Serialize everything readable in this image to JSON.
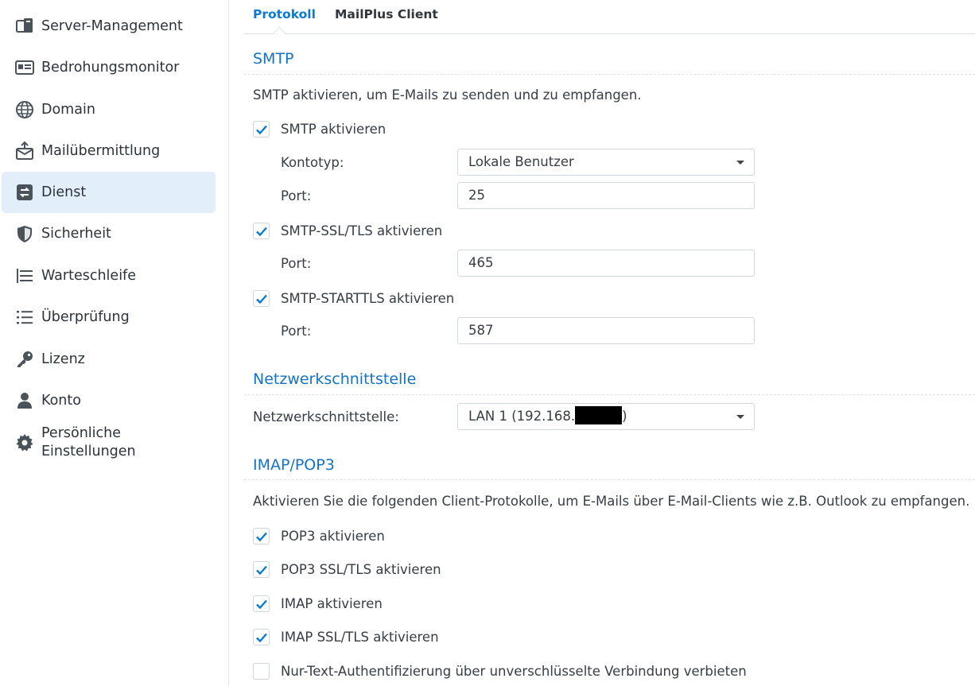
{
  "sidebar": {
    "items": [
      {
        "label": "Server-Management",
        "icon": "server-management-icon"
      },
      {
        "label": "Bedrohungsmonitor",
        "icon": "threat-monitor-icon"
      },
      {
        "label": "Domain",
        "icon": "globe-icon"
      },
      {
        "label": "Mailübermittlung",
        "icon": "mail-delivery-icon"
      },
      {
        "label": "Dienst",
        "icon": "service-icon",
        "active": true
      },
      {
        "label": "Sicherheit",
        "icon": "shield-icon"
      },
      {
        "label": "Warteschleife",
        "icon": "queue-icon"
      },
      {
        "label": "Überprüfung",
        "icon": "audit-list-icon"
      },
      {
        "label": "Lizenz",
        "icon": "key-icon"
      },
      {
        "label": "Konto",
        "icon": "person-icon"
      },
      {
        "label_line1": "Persönliche",
        "label_line2": "Einstellungen",
        "icon": "gear-icon"
      }
    ]
  },
  "tabs": [
    {
      "label": "Protokoll",
      "active": true
    },
    {
      "label": "MailPlus Client",
      "active": false
    }
  ],
  "smtp": {
    "title": "SMTP",
    "description": "SMTP aktivieren, um E-Mails zu senden und zu empfangen.",
    "enable_label": "SMTP aktivieren",
    "enable_checked": true,
    "account_type_label": "Kontotyp:",
    "account_type_value": "Lokale Benutzer",
    "port_label": "Port:",
    "port_value": "25",
    "ssl_label": "SMTP-SSL/TLS aktivieren",
    "ssl_checked": true,
    "ssl_port_label": "Port:",
    "ssl_port_value": "465",
    "starttls_label": "SMTP-STARTTLS aktivieren",
    "starttls_checked": true,
    "starttls_port_label": "Port:",
    "starttls_port_value": "587"
  },
  "network": {
    "title": "Netzwerkschnittstelle",
    "label": "Netzwerkschnittstelle:",
    "value_prefix": "LAN 1 (192.168.",
    "value_suffix": ")"
  },
  "imap": {
    "title": "IMAP/POP3",
    "description": "Aktivieren Sie die folgenden Client-Protokolle, um E-Mails über E-Mail-Clients wie z.B. Outlook zu empfangen.",
    "options": [
      {
        "label": "POP3 aktivieren",
        "checked": true
      },
      {
        "label": "POP3 SSL/TLS aktivieren",
        "checked": true
      },
      {
        "label": "IMAP aktivieren",
        "checked": true
      },
      {
        "label": "IMAP SSL/TLS aktivieren",
        "checked": true
      },
      {
        "label": "Nur-Text-Authentifizierung über unverschlüsselte Verbindung verbieten",
        "checked": false
      }
    ]
  },
  "colors": {
    "accent": "#0b7ad1",
    "section_title": "#1672c4",
    "active_nav_bg": "#e3eefb",
    "checkmark": "#0b7ad1"
  }
}
